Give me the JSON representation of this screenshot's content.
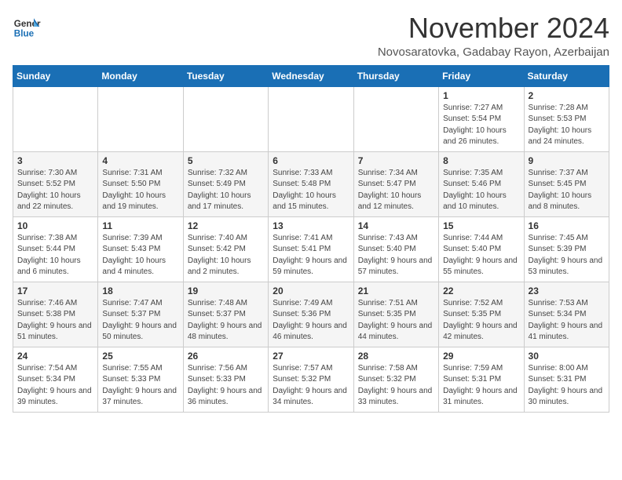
{
  "logo": {
    "line1": "General",
    "line2": "Blue"
  },
  "title": "November 2024",
  "location": "Novosaratovka, Gadabay Rayon, Azerbaijan",
  "weekdays": [
    "Sunday",
    "Monday",
    "Tuesday",
    "Wednesday",
    "Thursday",
    "Friday",
    "Saturday"
  ],
  "weeks": [
    [
      {
        "day": "",
        "info": ""
      },
      {
        "day": "",
        "info": ""
      },
      {
        "day": "",
        "info": ""
      },
      {
        "day": "",
        "info": ""
      },
      {
        "day": "",
        "info": ""
      },
      {
        "day": "1",
        "info": "Sunrise: 7:27 AM\nSunset: 5:54 PM\nDaylight: 10 hours and 26 minutes."
      },
      {
        "day": "2",
        "info": "Sunrise: 7:28 AM\nSunset: 5:53 PM\nDaylight: 10 hours and 24 minutes."
      }
    ],
    [
      {
        "day": "3",
        "info": "Sunrise: 7:30 AM\nSunset: 5:52 PM\nDaylight: 10 hours and 22 minutes."
      },
      {
        "day": "4",
        "info": "Sunrise: 7:31 AM\nSunset: 5:50 PM\nDaylight: 10 hours and 19 minutes."
      },
      {
        "day": "5",
        "info": "Sunrise: 7:32 AM\nSunset: 5:49 PM\nDaylight: 10 hours and 17 minutes."
      },
      {
        "day": "6",
        "info": "Sunrise: 7:33 AM\nSunset: 5:48 PM\nDaylight: 10 hours and 15 minutes."
      },
      {
        "day": "7",
        "info": "Sunrise: 7:34 AM\nSunset: 5:47 PM\nDaylight: 10 hours and 12 minutes."
      },
      {
        "day": "8",
        "info": "Sunrise: 7:35 AM\nSunset: 5:46 PM\nDaylight: 10 hours and 10 minutes."
      },
      {
        "day": "9",
        "info": "Sunrise: 7:37 AM\nSunset: 5:45 PM\nDaylight: 10 hours and 8 minutes."
      }
    ],
    [
      {
        "day": "10",
        "info": "Sunrise: 7:38 AM\nSunset: 5:44 PM\nDaylight: 10 hours and 6 minutes."
      },
      {
        "day": "11",
        "info": "Sunrise: 7:39 AM\nSunset: 5:43 PM\nDaylight: 10 hours and 4 minutes."
      },
      {
        "day": "12",
        "info": "Sunrise: 7:40 AM\nSunset: 5:42 PM\nDaylight: 10 hours and 2 minutes."
      },
      {
        "day": "13",
        "info": "Sunrise: 7:41 AM\nSunset: 5:41 PM\nDaylight: 9 hours and 59 minutes."
      },
      {
        "day": "14",
        "info": "Sunrise: 7:43 AM\nSunset: 5:40 PM\nDaylight: 9 hours and 57 minutes."
      },
      {
        "day": "15",
        "info": "Sunrise: 7:44 AM\nSunset: 5:40 PM\nDaylight: 9 hours and 55 minutes."
      },
      {
        "day": "16",
        "info": "Sunrise: 7:45 AM\nSunset: 5:39 PM\nDaylight: 9 hours and 53 minutes."
      }
    ],
    [
      {
        "day": "17",
        "info": "Sunrise: 7:46 AM\nSunset: 5:38 PM\nDaylight: 9 hours and 51 minutes."
      },
      {
        "day": "18",
        "info": "Sunrise: 7:47 AM\nSunset: 5:37 PM\nDaylight: 9 hours and 50 minutes."
      },
      {
        "day": "19",
        "info": "Sunrise: 7:48 AM\nSunset: 5:37 PM\nDaylight: 9 hours and 48 minutes."
      },
      {
        "day": "20",
        "info": "Sunrise: 7:49 AM\nSunset: 5:36 PM\nDaylight: 9 hours and 46 minutes."
      },
      {
        "day": "21",
        "info": "Sunrise: 7:51 AM\nSunset: 5:35 PM\nDaylight: 9 hours and 44 minutes."
      },
      {
        "day": "22",
        "info": "Sunrise: 7:52 AM\nSunset: 5:35 PM\nDaylight: 9 hours and 42 minutes."
      },
      {
        "day": "23",
        "info": "Sunrise: 7:53 AM\nSunset: 5:34 PM\nDaylight: 9 hours and 41 minutes."
      }
    ],
    [
      {
        "day": "24",
        "info": "Sunrise: 7:54 AM\nSunset: 5:34 PM\nDaylight: 9 hours and 39 minutes."
      },
      {
        "day": "25",
        "info": "Sunrise: 7:55 AM\nSunset: 5:33 PM\nDaylight: 9 hours and 37 minutes."
      },
      {
        "day": "26",
        "info": "Sunrise: 7:56 AM\nSunset: 5:33 PM\nDaylight: 9 hours and 36 minutes."
      },
      {
        "day": "27",
        "info": "Sunrise: 7:57 AM\nSunset: 5:32 PM\nDaylight: 9 hours and 34 minutes."
      },
      {
        "day": "28",
        "info": "Sunrise: 7:58 AM\nSunset: 5:32 PM\nDaylight: 9 hours and 33 minutes."
      },
      {
        "day": "29",
        "info": "Sunrise: 7:59 AM\nSunset: 5:31 PM\nDaylight: 9 hours and 31 minutes."
      },
      {
        "day": "30",
        "info": "Sunrise: 8:00 AM\nSunset: 5:31 PM\nDaylight: 9 hours and 30 minutes."
      }
    ]
  ]
}
